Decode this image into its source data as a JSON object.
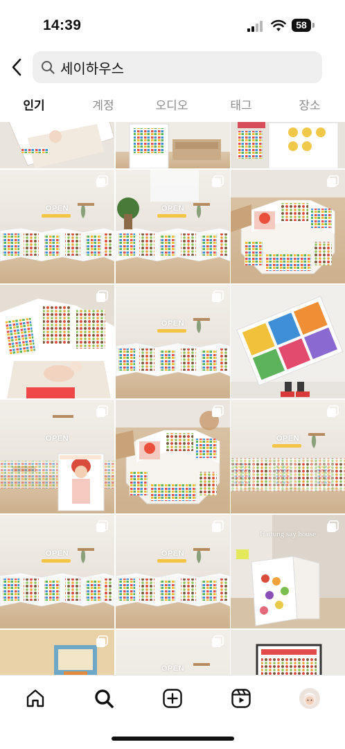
{
  "status_bar": {
    "time": "14:39",
    "battery": "58",
    "signal_icon": "signal-icon",
    "wifi_icon": "wifi-icon",
    "battery_icon": "battery-icon"
  },
  "search": {
    "query": "세이하우스",
    "back_icon": "chevron-left-icon",
    "search_icon": "search-icon"
  },
  "tabs": [
    {
      "label": "인기",
      "active": true
    },
    {
      "label": "계정",
      "active": false
    },
    {
      "label": "오디오",
      "active": false
    },
    {
      "label": "태그",
      "active": false
    },
    {
      "label": "장소",
      "active": false
    }
  ],
  "grid": {
    "open_label": "OPEN",
    "watermark": "Hattung say house",
    "posts": [
      {
        "scene": "crib-top",
        "multi": false
      },
      {
        "scene": "room-poster",
        "multi": false
      },
      {
        "scene": "flat-cards",
        "multi": false
      },
      {
        "scene": "open-fold",
        "multi": true
      },
      {
        "scene": "open-fold-plant",
        "multi": true
      },
      {
        "scene": "octagon",
        "multi": true
      },
      {
        "scene": "crib-panels",
        "multi": true
      },
      {
        "scene": "open-fold",
        "multi": true
      },
      {
        "scene": "hold-board",
        "multi": false
      },
      {
        "scene": "open-stand",
        "multi": true
      },
      {
        "scene": "octagon-chair",
        "multi": true
      },
      {
        "scene": "open-fold-wide",
        "multi": true
      },
      {
        "scene": "open-fold",
        "multi": true
      },
      {
        "scene": "open-fold",
        "multi": true
      },
      {
        "scene": "box-fruit",
        "multi": true
      },
      {
        "scene": "book",
        "multi": true
      },
      {
        "scene": "open-top",
        "multi": true
      },
      {
        "scene": "music-poster",
        "multi": false
      }
    ]
  },
  "bottom_nav": [
    {
      "icon": "home-icon"
    },
    {
      "icon": "search-icon",
      "active": true
    },
    {
      "icon": "create-icon"
    },
    {
      "icon": "reels-icon"
    },
    {
      "icon": "profile-avatar"
    }
  ],
  "colors": {
    "search_bg": "#efefef",
    "inactive_tab": "#8a8a8a",
    "floor": "#d8c3a5",
    "wall": "#efece7"
  }
}
